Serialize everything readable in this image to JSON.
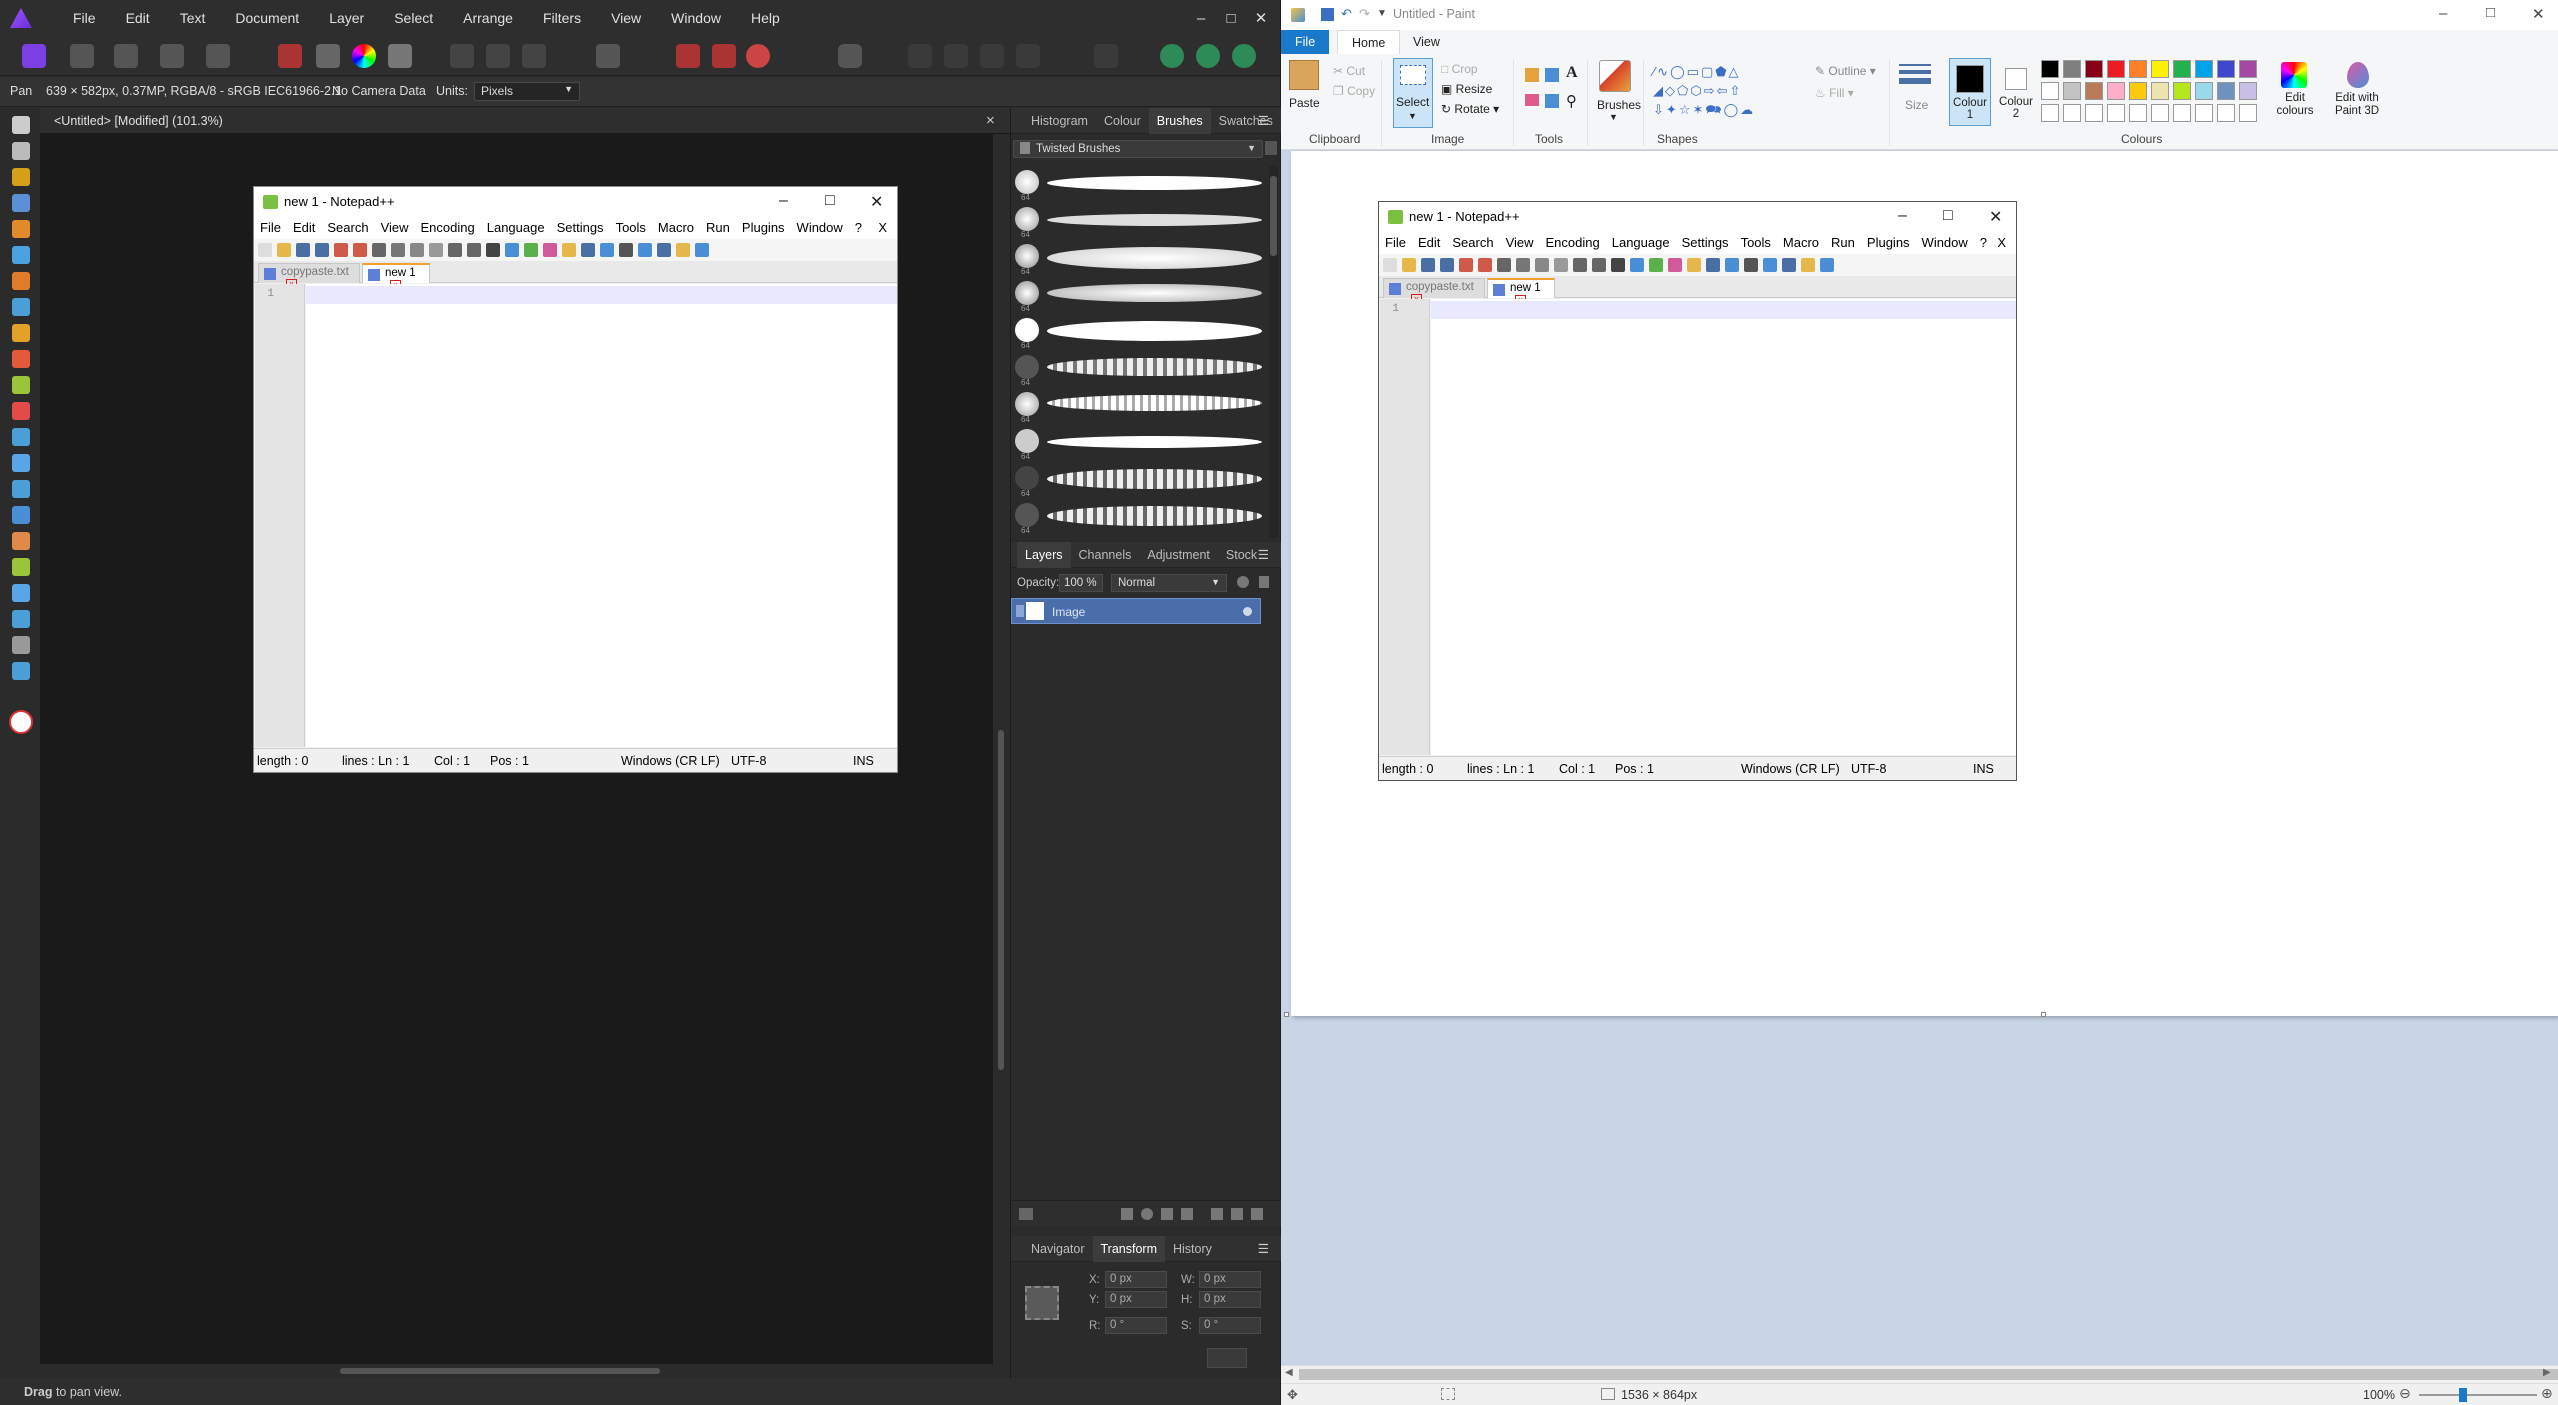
{
  "affinity": {
    "menu": [
      "File",
      "Edit",
      "Text",
      "Document",
      "Layer",
      "Select",
      "Arrange",
      "Filters",
      "View",
      "Window",
      "Help"
    ],
    "context": {
      "tool": "Pan",
      "info": "639 × 582px, 0.37MP, RGBA/8 - sRGB IEC61966-2.1",
      "camera": "No Camera Data",
      "units_label": "Units:",
      "units_value": "Pixels"
    },
    "doc_tab": "<Untitled> [Modified] (101.3%)",
    "doc_close": "×",
    "panels": {
      "top_tabs": [
        "Histogram",
        "Colour",
        "Brushes",
        "Swatches"
      ],
      "brush_category": "Twisted Brushes",
      "brush_size": "64",
      "layer_tabs": [
        "Layers",
        "Channels",
        "Adjustment",
        "Stock"
      ],
      "opacity_label": "Opacity:",
      "opacity_value": "100 %",
      "blend_mode": "Normal",
      "layer_name": "Image",
      "bottom_tabs": [
        "Navigator",
        "Transform",
        "History"
      ],
      "transform": {
        "x_label": "X:",
        "x": "0 px",
        "y_label": "Y:",
        "y": "0 px",
        "w_label": "W:",
        "w": "0 px",
        "h_label": "H:",
        "h": "0 px",
        "r_label": "R:",
        "r": "0 °",
        "s_label": "S:",
        "s": "0 °"
      }
    },
    "status_bold": "Drag",
    "status_rest": " to pan view."
  },
  "notepad": {
    "title": "new 1 - Notepad++",
    "menu": [
      "File",
      "Edit",
      "Search",
      "View",
      "Encoding",
      "Language",
      "Settings",
      "Tools",
      "Macro",
      "Run",
      "Plugins",
      "Window",
      "?"
    ],
    "menu_close": "X",
    "tabs": [
      "copypaste.txt",
      "new 1"
    ],
    "line_number": "1",
    "status": {
      "length": "length : 0",
      "lines": "lines : Ln : 1",
      "col": "Col : 1",
      "pos": "Pos : 1",
      "eol": "Windows (CR LF)",
      "encoding": "UTF-8",
      "mode": "INS"
    }
  },
  "paint": {
    "title": "Untitled - Paint",
    "tabs": [
      "File",
      "Home",
      "View"
    ],
    "clipboard": {
      "paste": "Paste",
      "cut": "Cut",
      "copy": "Copy",
      "label": "Clipboard"
    },
    "image": {
      "select": "Select",
      "crop": "Crop",
      "resize": "Resize",
      "rotate": "Rotate",
      "label": "Image"
    },
    "tools_label": "Tools",
    "brushes": "Brushes",
    "shapes": {
      "outline": "Outline",
      "fill": "Fill",
      "label": "Shapes"
    },
    "size": "Size",
    "colour1": "Colour 1",
    "colour2": "Colour 2",
    "edit_colours": "Edit colours",
    "edit_paint3d": "Edit with Paint 3D",
    "colours_label": "Colours",
    "palette_row1": [
      "#000000",
      "#7f7f7f",
      "#880015",
      "#ed1c24",
      "#ff7f27",
      "#fff200",
      "#22b14c",
      "#00a2e8",
      "#3f48cc",
      "#a349a4"
    ],
    "palette_row2": [
      "#ffffff",
      "#c3c3c3",
      "#b97a57",
      "#ffaec9",
      "#ffc90e",
      "#efe4b0",
      "#b5e61d",
      "#99d9ea",
      "#7092be",
      "#c8bfe7"
    ],
    "status_size": "1536 × 864px",
    "zoom": "100%"
  }
}
